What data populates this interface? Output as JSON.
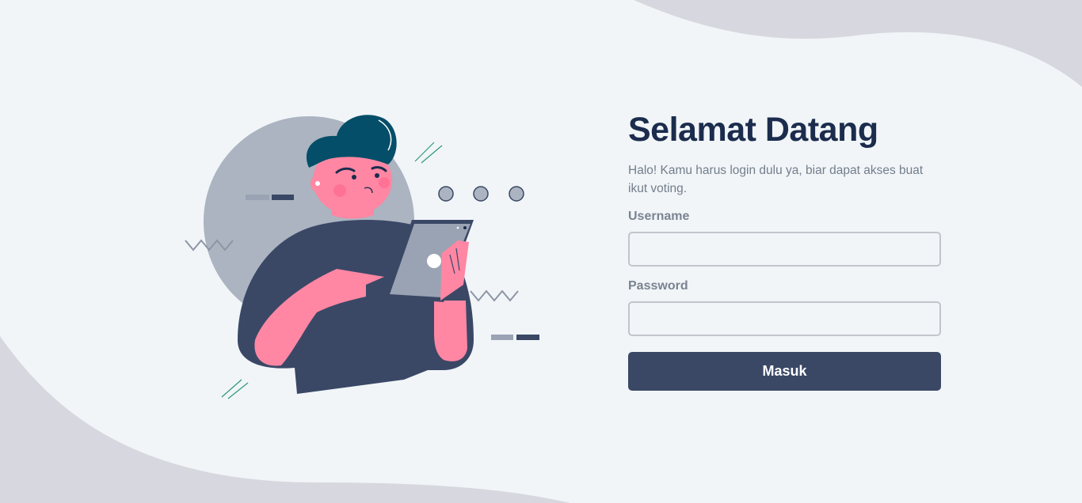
{
  "welcome": {
    "title": "Selamat Datang",
    "subtitle": "Halo! Kamu harus login dulu ya, biar dapat akses buat ikut voting."
  },
  "form": {
    "username_label": "Username",
    "username_value": "",
    "password_label": "Password",
    "password_value": "",
    "submit_label": "Masuk"
  },
  "colors": {
    "background": "#f1f5f8",
    "wave": "#d7d8df",
    "title": "#1b2c4d",
    "button": "#3a4866",
    "illustration_skin": "#ff87a3",
    "illustration_hair": "#054e69",
    "illustration_shirt": "#3a4866"
  },
  "icons": {
    "illustration": "person-with-tablet-illustration"
  }
}
